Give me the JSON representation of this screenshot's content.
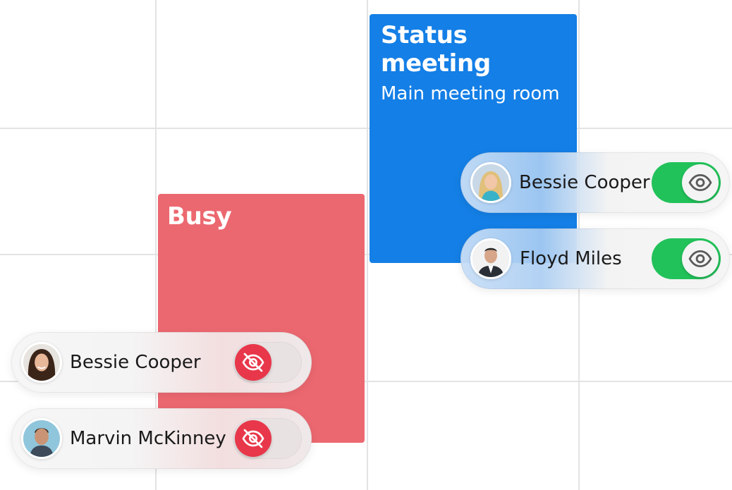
{
  "events": [
    {
      "title": "Status meeting",
      "subtitle": "Main meeting room",
      "color": "#147fe6"
    },
    {
      "title": "Busy",
      "color": "#ec6870"
    }
  ],
  "participants": [
    {
      "name": "Bessie Cooper",
      "visible": true,
      "toggle_icon": "eye-icon"
    },
    {
      "name": "Floyd Miles",
      "visible": true,
      "toggle_icon": "eye-icon"
    },
    {
      "name": "Bessie Cooper",
      "visible": false,
      "toggle_icon": "eye-off-icon"
    },
    {
      "name": "Marvin McKinney",
      "visible": false,
      "toggle_icon": "eye-off-icon"
    }
  ],
  "colors": {
    "toggle_on": "#22c25a",
    "toggle_off_knob": "#e8374a",
    "grid_line": "#e3e3e3"
  }
}
